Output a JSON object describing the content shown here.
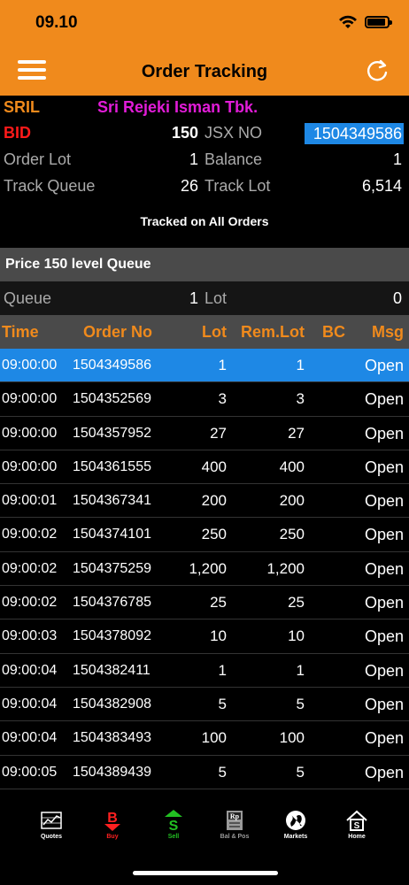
{
  "status": {
    "time": "09.10"
  },
  "header": {
    "title": "Order Tracking"
  },
  "info": {
    "code": "SRIL",
    "company": "Sri Rejeki Isman Tbk.",
    "side": "BID",
    "price": "150",
    "jsx_label": "JSX NO",
    "jsx_value": "1504349586",
    "order_lot_label": "Order Lot",
    "order_lot": "1",
    "balance_label": "Balance",
    "balance": "1",
    "track_queue_label": "Track Queue",
    "track_queue": "26",
    "track_lot_label": "Track Lot",
    "track_lot": "6,514",
    "tracked_text": "Tracked on All Orders"
  },
  "queue": {
    "header": "Price 150 level Queue",
    "queue_label": "Queue",
    "queue_value": "1",
    "lot_label": "Lot",
    "lot_value": "0"
  },
  "table": {
    "headers": {
      "time": "Time",
      "order": "Order No",
      "lot": "Lot",
      "rem": "Rem.Lot",
      "bc": "BC",
      "msg": "Msg"
    },
    "rows": [
      {
        "time": "09:00:00",
        "order": "1504349586",
        "lot": "1",
        "rem": "1",
        "bc": "",
        "msg": "Open",
        "selected": true
      },
      {
        "time": "09:00:00",
        "order": "1504352569",
        "lot": "3",
        "rem": "3",
        "bc": "",
        "msg": "Open"
      },
      {
        "time": "09:00:00",
        "order": "1504357952",
        "lot": "27",
        "rem": "27",
        "bc": "",
        "msg": "Open"
      },
      {
        "time": "09:00:00",
        "order": "1504361555",
        "lot": "400",
        "rem": "400",
        "bc": "",
        "msg": "Open"
      },
      {
        "time": "09:00:01",
        "order": "1504367341",
        "lot": "200",
        "rem": "200",
        "bc": "",
        "msg": "Open"
      },
      {
        "time": "09:00:02",
        "order": "1504374101",
        "lot": "250",
        "rem": "250",
        "bc": "",
        "msg": "Open"
      },
      {
        "time": "09:00:02",
        "order": "1504375259",
        "lot": "1,200",
        "rem": "1,200",
        "bc": "",
        "msg": "Open"
      },
      {
        "time": "09:00:02",
        "order": "1504376785",
        "lot": "25",
        "rem": "25",
        "bc": "",
        "msg": "Open"
      },
      {
        "time": "09:00:03",
        "order": "1504378092",
        "lot": "10",
        "rem": "10",
        "bc": "",
        "msg": "Open"
      },
      {
        "time": "09:00:04",
        "order": "1504382411",
        "lot": "1",
        "rem": "1",
        "bc": "",
        "msg": "Open"
      },
      {
        "time": "09:00:04",
        "order": "1504382908",
        "lot": "5",
        "rem": "5",
        "bc": "",
        "msg": "Open"
      },
      {
        "time": "09:00:04",
        "order": "1504383493",
        "lot": "100",
        "rem": "100",
        "bc": "",
        "msg": "Open"
      },
      {
        "time": "09:00:05",
        "order": "1504389439",
        "lot": "5",
        "rem": "5",
        "bc": "",
        "msg": "Open"
      }
    ]
  },
  "nav": [
    {
      "label": "Quotes",
      "icon": "quotes-icon",
      "color": "#ffffff"
    },
    {
      "label": "Buy",
      "icon": "buy-icon",
      "color": "#ff2020"
    },
    {
      "label": "Sell",
      "icon": "sell-icon",
      "color": "#22c022"
    },
    {
      "label": "Bal & Pos",
      "icon": "balance-position-icon",
      "color": "#9a9a9a"
    },
    {
      "label": "Markets",
      "icon": "markets-icon",
      "color": "#ffffff"
    },
    {
      "label": "Home",
      "icon": "home-icon",
      "color": "#ffffff"
    }
  ],
  "colors": {
    "accent": "#f08a1c",
    "selected": "#1e88e5",
    "company": "#e21cd8",
    "bid": "#ff1a1a"
  }
}
